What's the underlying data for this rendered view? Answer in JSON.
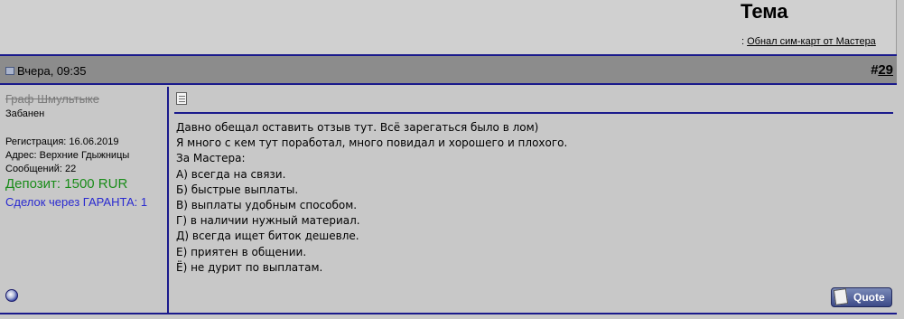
{
  "header": {
    "title": "Тема",
    "thread_prefix": ":",
    "thread_link": "Обнал сим-карт от Мастера"
  },
  "post": {
    "date": "Вчера, 09:35",
    "number_prefix": "#",
    "number": "29",
    "user": {
      "name": "Граф Шмультыке",
      "status": "Забанен",
      "registration": "Регистрация: 16.06.2019",
      "address": "Адрес: Верхние Гдыжницы",
      "posts": "Сообщений: 22",
      "deposit": "Депозит: 1500 RUR",
      "deals": "Сделок через ГАРАНТА: 1"
    },
    "message_lines": [
      "Давно обещал оставить отзыв тут. Всё зарегаться было в лом)",
      "Я много с кем тут поработал, много повидал и хорошего и плохого.",
      "За Мастера:",
      "А) всегда на связи.",
      "Б) быстрые выплаты.",
      "В) выплаты удобным способом.",
      "Г) в наличии нужный материал.",
      "Д) всегда ищет биток дешевле.",
      "Е) приятен в общении.",
      "Ё) не дурит по выплатам."
    ],
    "quote_label": "Quote"
  },
  "icons": {
    "post_icon": "post-status-icon",
    "doc_icon": "document-icon",
    "online_icon": "user-offline-status-icon",
    "quote_icon": "quote-icon"
  },
  "colors": {
    "accent_border": "#1a1a8c",
    "deposit": "#1a8c1a",
    "deals": "#2a2ad0",
    "header_bar": "#8c8c8c",
    "background": "#c8c8c8"
  }
}
